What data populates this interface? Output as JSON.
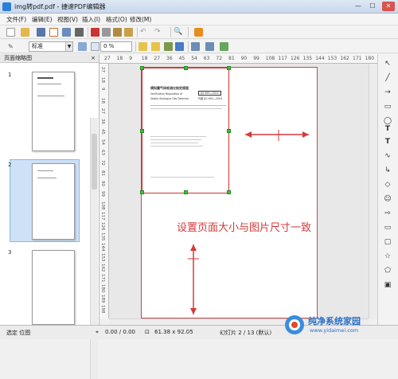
{
  "window": {
    "title": "img转pdf.pdf - 捷速PDF编辑器"
  },
  "menu": [
    "文件(F)",
    "编辑(E)",
    "视图(V)",
    "插入(I)",
    "格式(O)",
    "修改(M)"
  ],
  "toolbar2": {
    "style_value": "标准",
    "percent_value": "0 %"
  },
  "panel": {
    "title": "页面缩略图",
    "close_label": "×",
    "thumbs": [
      "1",
      "2",
      "3"
    ]
  },
  "ruler": {
    "h_ticks": [
      "27",
      "18",
      "9",
      "18",
      "27",
      "36",
      "45",
      "54",
      "63",
      "72",
      "81",
      "90",
      "99",
      "108",
      "117",
      "126",
      "135",
      "144",
      "153",
      "162",
      "171",
      "180"
    ],
    "v_ticks": [
      "27",
      "18",
      "9",
      "18",
      "27",
      "36",
      "45",
      "54",
      "63",
      "72",
      "81",
      "90",
      "99",
      "108",
      "117",
      "126",
      "135",
      "144",
      "153",
      "162",
      "171",
      "180",
      "189",
      "198"
    ]
  },
  "document": {
    "heading": "模拟量气体检测仪检定规程",
    "subheading": "Verification Regulation of",
    "subheading2": "Stable Analogue Gas Detector",
    "code": "JJG 693—2011",
    "code2": "代替 JJG 693—2004"
  },
  "caption": "设置页面大小与图片尺寸一致",
  "status": {
    "mode": "选定 位图",
    "coords": "0.00 / 0.00",
    "size": "61.38 x 92.05",
    "page": "幻灯片 2 / 13 (默认)"
  },
  "watermark": {
    "brand": "纯净系统家园",
    "url": "www.yidaimei.com"
  },
  "colors": {
    "accent": "#2c7fd6",
    "annotation": "#d43a3a",
    "handle": "#37c837"
  }
}
